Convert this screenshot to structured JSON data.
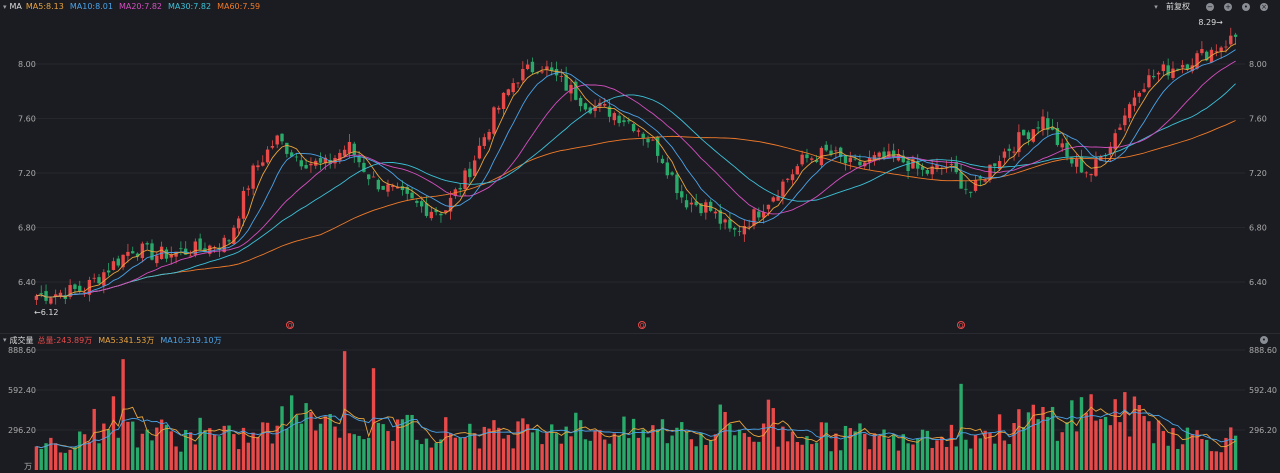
{
  "header": {
    "indicator": "MA",
    "ma_labels": [
      {
        "text": "MA5:8.13",
        "color": "#e8a33c"
      },
      {
        "text": "MA10:8.01",
        "color": "#4aa3e8"
      },
      {
        "text": "MA20:7.82",
        "color": "#d44fc0"
      },
      {
        "text": "MA30:7.82",
        "color": "#3cc0d8"
      },
      {
        "text": "MA60:7.59",
        "color": "#f07a2a"
      }
    ],
    "adjust": "前复权"
  },
  "volume_header": {
    "title": "成交量",
    "labels": [
      {
        "text": "总量:243.89万",
        "color": "#e84a4a"
      },
      {
        "text": "MA5:341.53万",
        "color": "#e8a33c"
      },
      {
        "text": "MA10:319.10万",
        "color": "#4aa3e8"
      }
    ]
  },
  "colors": {
    "up": "#e84a4a",
    "down": "#2aaa6a",
    "ma5": "#e8a33c",
    "ma10": "#4aa3e8",
    "ma20": "#d44fc0",
    "ma30": "#3cc0d8",
    "ma60": "#f07a2a"
  },
  "chart_data": [
    {
      "type": "candlestick",
      "y_ticks": [
        "8.00",
        "7.60",
        "7.20",
        "6.80",
        "6.40"
      ],
      "ylim": [
        6.1,
        8.35
      ],
      "annotations": {
        "max_label": "8.29→",
        "min_label": "←6.12"
      },
      "event_markers": [
        "Q",
        "Q",
        "Q"
      ],
      "close_keypoints": [
        6.3,
        6.32,
        6.35,
        6.5,
        6.65,
        6.6,
        6.62,
        6.65,
        6.7,
        7.2,
        7.45,
        7.3,
        7.25,
        7.4,
        7.15,
        7.05,
        6.95,
        6.92,
        7.2,
        7.6,
        7.9,
        8.0,
        7.85,
        7.7,
        7.65,
        7.55,
        7.35,
        7.0,
        6.95,
        6.75,
        6.9,
        7.1,
        7.3,
        7.35,
        7.25,
        7.3,
        7.3,
        7.2,
        7.25,
        7.05,
        7.3,
        7.45,
        7.6,
        7.3,
        7.2,
        7.5,
        7.85,
        7.95,
        8.02,
        8.1,
        8.2
      ]
    },
    {
      "type": "bar",
      "y_ticks": [
        "888.60",
        "592.40",
        "296.20"
      ],
      "unit": "万",
      "ylim": [
        0,
        888.6
      ],
      "volume_keypoints": [
        180,
        200,
        260,
        420,
        300,
        280,
        240,
        260,
        230,
        250,
        300,
        480,
        350,
        400,
        280,
        300,
        320,
        280,
        300,
        260,
        280,
        350,
        320,
        300,
        290,
        260,
        300,
        250,
        280,
        320,
        260,
        250,
        300,
        240,
        260,
        230,
        250,
        300,
        280,
        260,
        280,
        340,
        380,
        400,
        450,
        420,
        380,
        300,
        250,
        220,
        240
      ]
    }
  ]
}
